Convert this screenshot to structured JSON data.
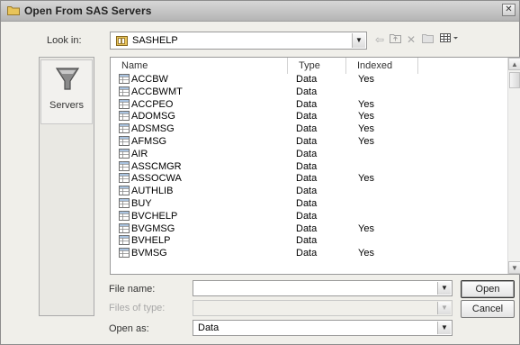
{
  "window": {
    "title": "Open From SAS Servers"
  },
  "lookin": {
    "label": "Look in:",
    "value": "SASHELP"
  },
  "places": {
    "servers_label": "Servers"
  },
  "columns": {
    "name": "Name",
    "type": "Type",
    "indexed": "Indexed"
  },
  "files": [
    {
      "name": "ACCBW",
      "type": "Data",
      "indexed": "Yes"
    },
    {
      "name": "ACCBWMT",
      "type": "Data",
      "indexed": ""
    },
    {
      "name": "ACCPEO",
      "type": "Data",
      "indexed": "Yes"
    },
    {
      "name": "ADOMSG",
      "type": "Data",
      "indexed": "Yes"
    },
    {
      "name": "ADSMSG",
      "type": "Data",
      "indexed": "Yes"
    },
    {
      "name": "AFMSG",
      "type": "Data",
      "indexed": "Yes"
    },
    {
      "name": "AIR",
      "type": "Data",
      "indexed": ""
    },
    {
      "name": "ASSCMGR",
      "type": "Data",
      "indexed": ""
    },
    {
      "name": "ASSOCWA",
      "type": "Data",
      "indexed": "Yes"
    },
    {
      "name": "AUTHLIB",
      "type": "Data",
      "indexed": ""
    },
    {
      "name": "BUY",
      "type": "Data",
      "indexed": ""
    },
    {
      "name": "BVCHELP",
      "type": "Data",
      "indexed": ""
    },
    {
      "name": "BVGMSG",
      "type": "Data",
      "indexed": "Yes"
    },
    {
      "name": "BVHELP",
      "type": "Data",
      "indexed": ""
    },
    {
      "name": "BVMSG",
      "type": "Data",
      "indexed": "Yes"
    }
  ],
  "filename": {
    "label": "File name:",
    "value": ""
  },
  "filetype": {
    "label": "Files of type:",
    "value": ""
  },
  "openas": {
    "label": "Open as:",
    "value": "Data"
  },
  "buttons": {
    "open": "Open",
    "cancel": "Cancel"
  },
  "colors": {
    "dialog_bg": "#f0efea",
    "folder_yellow": "#e8c45a",
    "icon_gray": "#8a8a8a"
  }
}
